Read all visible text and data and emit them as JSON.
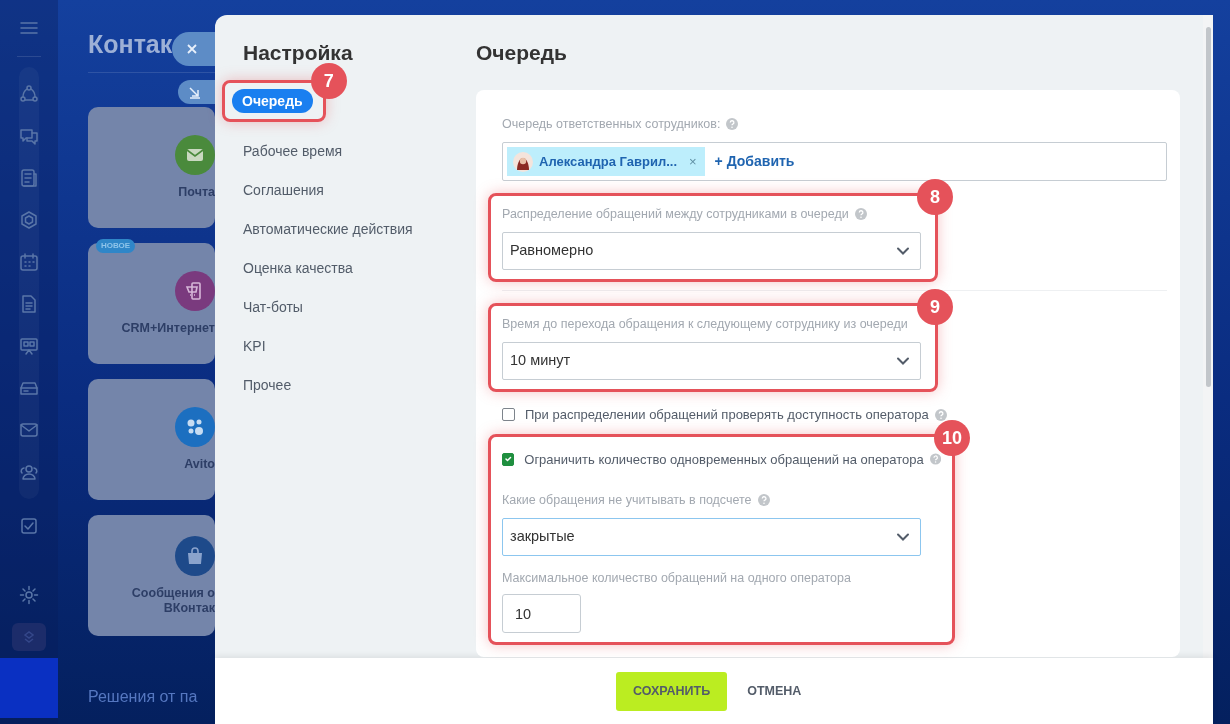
{
  "background": {
    "title": "Контак",
    "footer_text": "Решения от па",
    "cards": [
      {
        "label": "Почта",
        "color": "#4a8a3c"
      },
      {
        "label": "CRM+Интернет",
        "color": "#7a3a7e",
        "badge": "НОВОЕ"
      },
      {
        "label": "Avito",
        "color": "#1c6fc0"
      },
      {
        "label": "Сообщения о",
        "label_2": "ВКонтак",
        "color": "#1e4a8a"
      }
    ]
  },
  "panel": {
    "title": "Настройка",
    "heading": "Очередь",
    "nav": [
      {
        "label": "Очередь",
        "selected": true,
        "callout": "7"
      },
      {
        "label": "Рабочее время",
        "selected": false
      },
      {
        "label": "Соглашения",
        "selected": false
      },
      {
        "label": "Автоматические действия",
        "selected": false
      },
      {
        "label": "Оценка качества",
        "selected": false
      },
      {
        "label": "Чат-боты",
        "selected": false
      },
      {
        "label": "KPI",
        "selected": false
      },
      {
        "label": "Прочее",
        "selected": false
      }
    ],
    "queue_field": {
      "label": "Очередь ответственных сотрудников:",
      "help": true,
      "chips": [
        {
          "name": "Александра Гаврил...",
          "remove": "×"
        }
      ],
      "add_link": "+ Добавить"
    },
    "blocks": [
      {
        "kind": "select",
        "label": "Распределение обращений между сотрудниками в очереди",
        "help": true,
        "value": "Равномерно",
        "callout": "8"
      },
      {
        "kind": "divider"
      },
      {
        "kind": "select",
        "label": "Время до перехода обращения к следующему сотруднику из очереди",
        "value": "10 минут",
        "callout": "9"
      },
      {
        "kind": "checkbox",
        "label": "При распределении обращений проверять доступность оператора",
        "checked": false,
        "help": true
      },
      {
        "kind": "group",
        "callout": "10",
        "items": [
          {
            "kind": "checkbox",
            "label": "Ограничить количество одновременных обращений на оператора",
            "checked": true,
            "help": true
          },
          {
            "kind": "select",
            "label": "Какие обращения не учитывать в подсчете",
            "help": true,
            "value": "закрытые",
            "focused": true
          },
          {
            "kind": "input",
            "label": "Максимальное количество обращений на одного оператора",
            "value": "10"
          }
        ]
      }
    ],
    "footer": {
      "buttons": [
        {
          "label": "СОХРАНИТЬ",
          "kind": "primary"
        },
        {
          "label": "ОТМЕНА",
          "kind": "link"
        }
      ]
    }
  }
}
